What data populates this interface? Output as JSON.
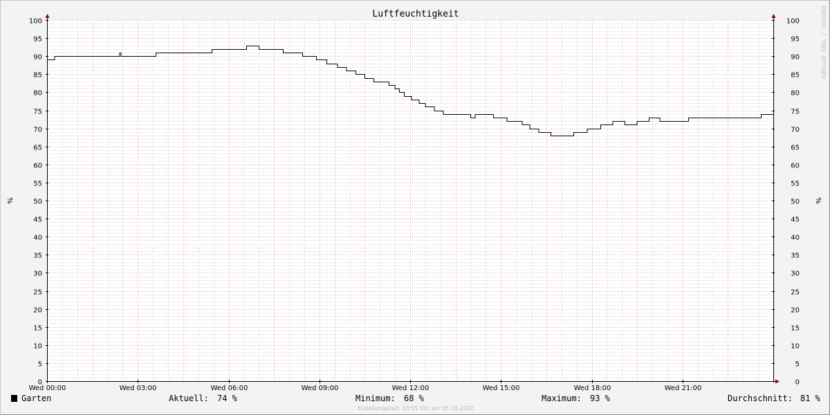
{
  "chart_data": {
    "type": "line",
    "title": "Luftfeuchtigkeit",
    "unit_label_left": "%",
    "unit_label_right": "%",
    "watermark": "RRDTOOL / TOBI OETIKER",
    "ylim": [
      0,
      100
    ],
    "y_ticks": [
      0,
      5,
      10,
      15,
      20,
      25,
      30,
      35,
      40,
      45,
      50,
      55,
      60,
      65,
      70,
      75,
      80,
      85,
      90,
      95,
      100
    ],
    "xlim_hours": [
      0,
      24
    ],
    "x_tick_labels": [
      {
        "label": "Wed 00:00",
        "hour": 0
      },
      {
        "label": "Wed 03:00",
        "hour": 3
      },
      {
        "label": "Wed 06:00",
        "hour": 6
      },
      {
        "label": "Wed 09:00",
        "hour": 9
      },
      {
        "label": "Wed 12:00",
        "hour": 12
      },
      {
        "label": "Wed 15:00",
        "hour": 15
      },
      {
        "label": "Wed 18:00",
        "hour": 18
      },
      {
        "label": "Wed 21:00",
        "hour": 21
      }
    ],
    "grid": true,
    "series": [
      {
        "name": "Garten",
        "color": "#000000",
        "x_hours": [
          0.0,
          0.2,
          0.25,
          2.35,
          2.4,
          2.45,
          3.55,
          3.6,
          5.4,
          5.45,
          6.55,
          6.6,
          6.95,
          7.0,
          7.75,
          7.8,
          8.4,
          8.45,
          8.85,
          8.9,
          9.2,
          9.25,
          9.5,
          9.6,
          9.8,
          9.9,
          10.0,
          10.15,
          10.2,
          10.4,
          10.5,
          10.8,
          11.0,
          11.3,
          11.5,
          11.65,
          11.8,
          12.05,
          12.1,
          12.3,
          12.5,
          12.8,
          13.1,
          13.9,
          14.0,
          14.15,
          14.25,
          14.75,
          14.8,
          15.2,
          15.25,
          15.7,
          15.75,
          15.95,
          16.05,
          16.25,
          16.3,
          16.65,
          16.7,
          17.35,
          17.4,
          17.8,
          17.85,
          18.2,
          18.3,
          18.6,
          18.7,
          19.0,
          19.1,
          19.45,
          19.5,
          19.8,
          19.9,
          20.2,
          20.25,
          21.1,
          21.2,
          23.55,
          23.6,
          24.0
        ],
        "y_values": [
          89,
          89,
          90,
          90,
          91,
          90,
          90,
          91,
          91,
          92,
          92,
          93,
          93,
          92,
          92,
          91,
          91,
          90,
          90,
          89,
          89,
          88,
          88,
          87,
          87,
          86,
          86,
          86,
          85,
          85,
          84,
          83,
          83,
          82,
          81,
          80,
          79,
          78,
          78,
          77,
          76,
          75,
          74,
          74,
          73,
          74,
          74,
          73,
          73,
          72,
          72,
          71,
          71,
          70,
          70,
          69,
          69,
          68,
          68,
          68,
          69,
          69,
          70,
          70,
          71,
          71,
          72,
          72,
          71,
          71,
          72,
          72,
          73,
          73,
          72,
          72,
          73,
          73,
          74,
          74
        ]
      }
    ],
    "legend": {
      "series_name": "Garten",
      "swatch_color": "#000000",
      "stats": [
        {
          "label": "Aktuell:",
          "value": "74 %"
        },
        {
          "label": "Minimum:",
          "value": "68 %"
        },
        {
          "label": "Maximum:",
          "value": "93 %"
        },
        {
          "label": "Durchschnitt:",
          "value": "81 %"
        }
      ]
    },
    "footer": "Erstellungszeit: 23:55 Uhr am 05.10.2022"
  },
  "colors": {
    "background": "#f3f3f3",
    "plot_area": "#ffffff",
    "major_grid": "#ff9a9a",
    "minor_grid": "#c8c8c8",
    "axis": "#000000",
    "arrow": "#8b0000",
    "line": "#000000"
  }
}
